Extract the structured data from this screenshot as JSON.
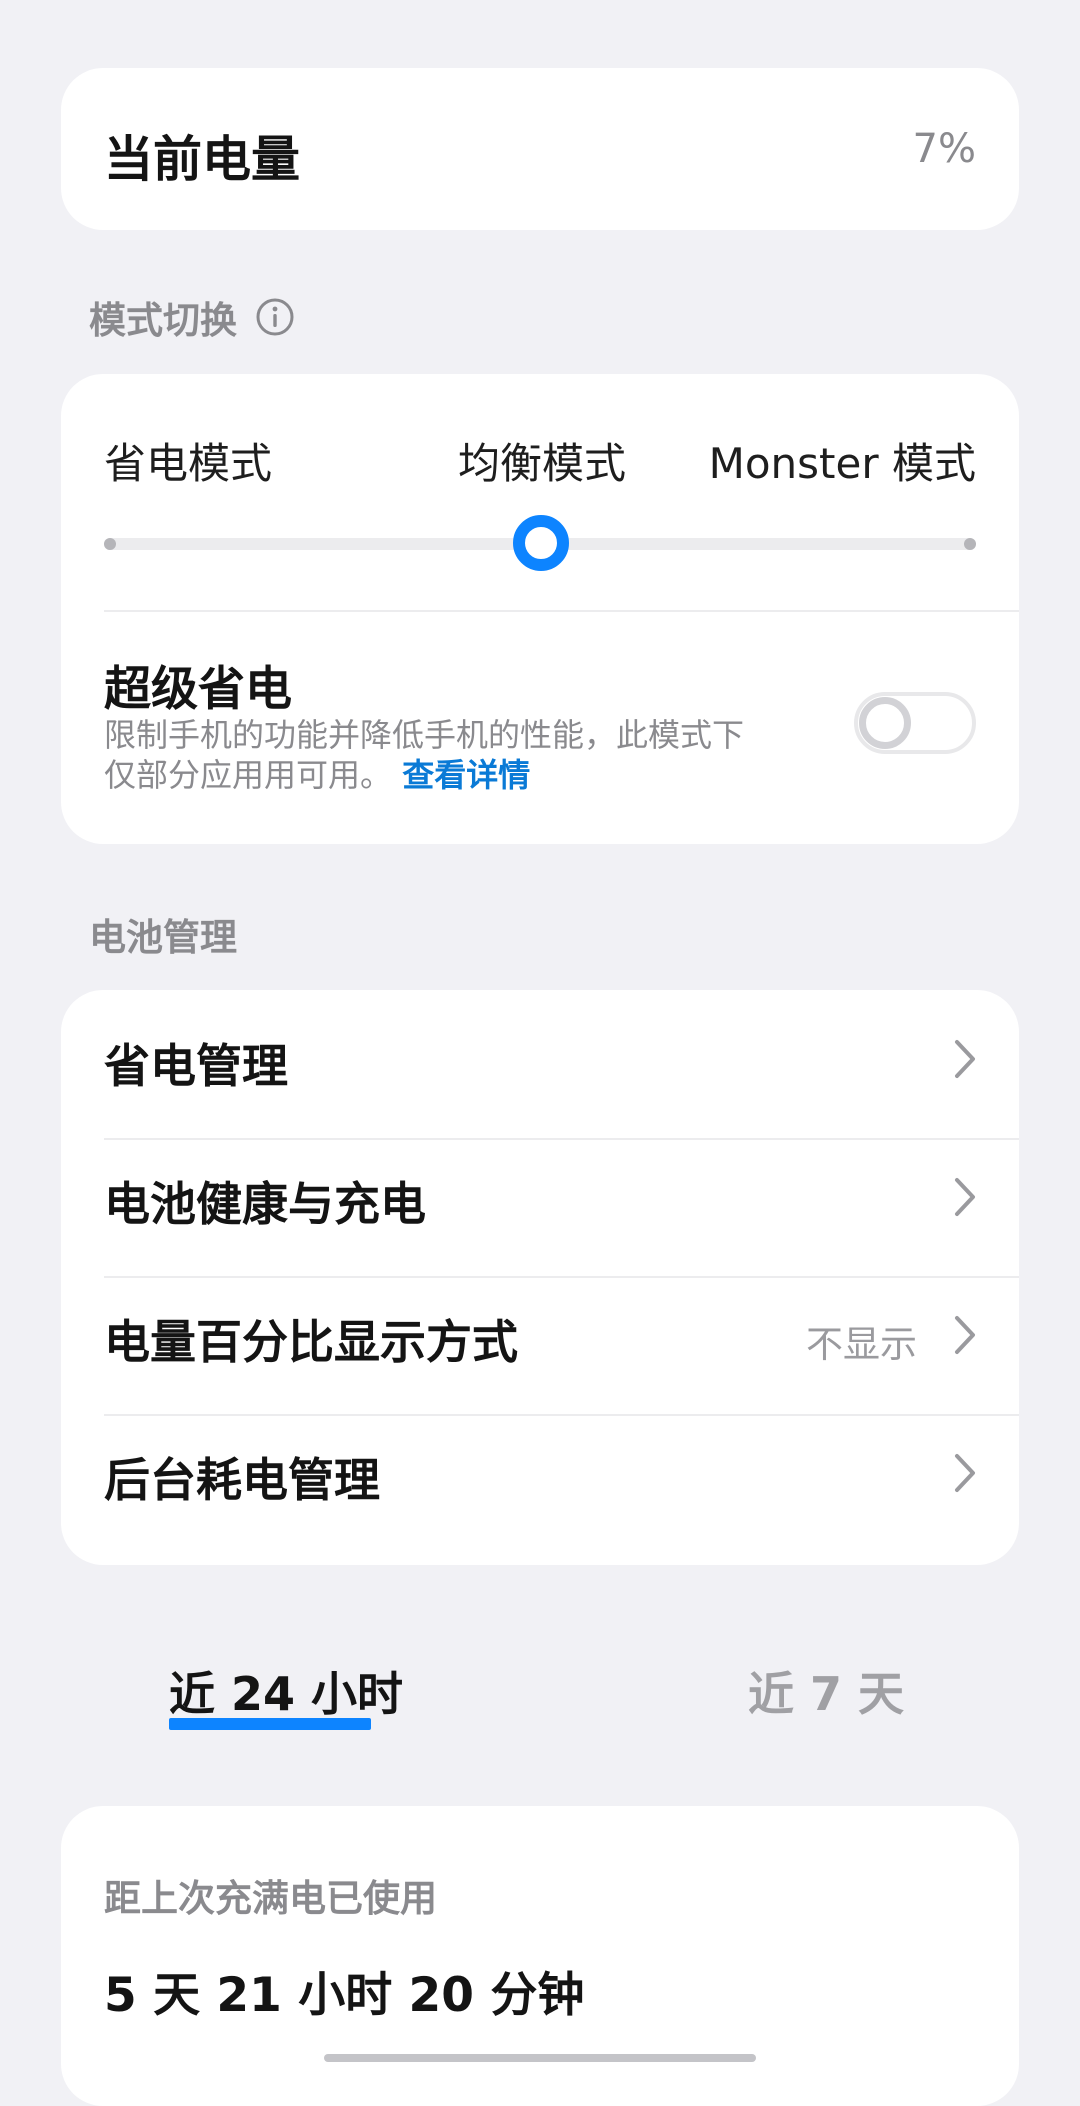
{
  "battery": {
    "title": "当前电量",
    "value": "7%"
  },
  "mode_section": {
    "header": "模式切换",
    "modes": [
      "省电模式",
      "均衡模式",
      "Monster 模式"
    ],
    "selected_index": 1,
    "super_save": {
      "title": "超级省电",
      "desc_line1": "限制手机的功能并降低手机的性能，此模式下",
      "desc_line2": "仅部分应用用可用。",
      "link": "查看详情",
      "enabled": false
    }
  },
  "battery_management": {
    "header": "电池管理",
    "items": [
      {
        "label": "省电管理",
        "value": ""
      },
      {
        "label": "电池健康与充电",
        "value": ""
      },
      {
        "label": "电量百分比显示方式",
        "value": "不显示"
      },
      {
        "label": "后台耗电管理",
        "value": ""
      }
    ]
  },
  "tabs": [
    {
      "label": "近 24 小时",
      "active": true
    },
    {
      "label": "近 7 天",
      "active": false
    }
  ],
  "usage": {
    "label": "距上次充满电已使用",
    "value": "5 天 21 小时 20 分钟"
  },
  "colors": {
    "accent": "#0d84ff",
    "link": "#0a7ad6",
    "background": "#f1f1f5"
  },
  "icons": {
    "info": "info-icon",
    "chevron": "chevron-right-icon"
  }
}
